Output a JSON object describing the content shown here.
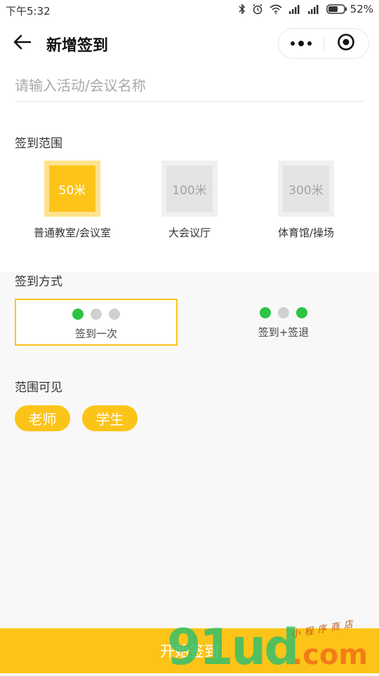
{
  "status_bar": {
    "time": "下午5:32",
    "battery": "52%"
  },
  "nav": {
    "title": "新增签到"
  },
  "form": {
    "name_placeholder": "请输入活动/会议名称",
    "name_value": ""
  },
  "range": {
    "label": "签到范围",
    "options": [
      {
        "distance": "50米",
        "caption": "普通教室/会议室",
        "selected": true
      },
      {
        "distance": "100米",
        "caption": "大会议厅",
        "selected": false
      },
      {
        "distance": "300米",
        "caption": "体育馆/操场",
        "selected": false
      }
    ]
  },
  "method": {
    "label": "签到方式",
    "options": [
      {
        "label": "签到一次",
        "selected": true,
        "dots": [
          "green",
          "gray",
          "gray"
        ]
      },
      {
        "label": "签到+签退",
        "selected": false,
        "dots": [
          "green",
          "gray",
          "green"
        ]
      }
    ]
  },
  "visibility": {
    "label": "范围可见",
    "options": [
      "老师",
      "学生"
    ]
  },
  "bottom": {
    "start_label": "开始签到"
  },
  "watermark": {
    "brand": "91ud",
    "tagline": "小程序商店",
    "domain": ".com"
  },
  "colors": {
    "accent": "#fcc419",
    "accent_light": "#ffe28c",
    "dot_active": "#2dc444",
    "dot_inactive": "#d0d0d0"
  },
  "icons": {
    "back": "arrow-left-icon",
    "more": "more-dots-icon",
    "close": "target-circle-icon",
    "bluetooth": "bluetooth-icon",
    "alarm": "alarm-icon",
    "wifi": "wifi-icon",
    "signal": "signal-icon",
    "battery": "battery-icon"
  }
}
